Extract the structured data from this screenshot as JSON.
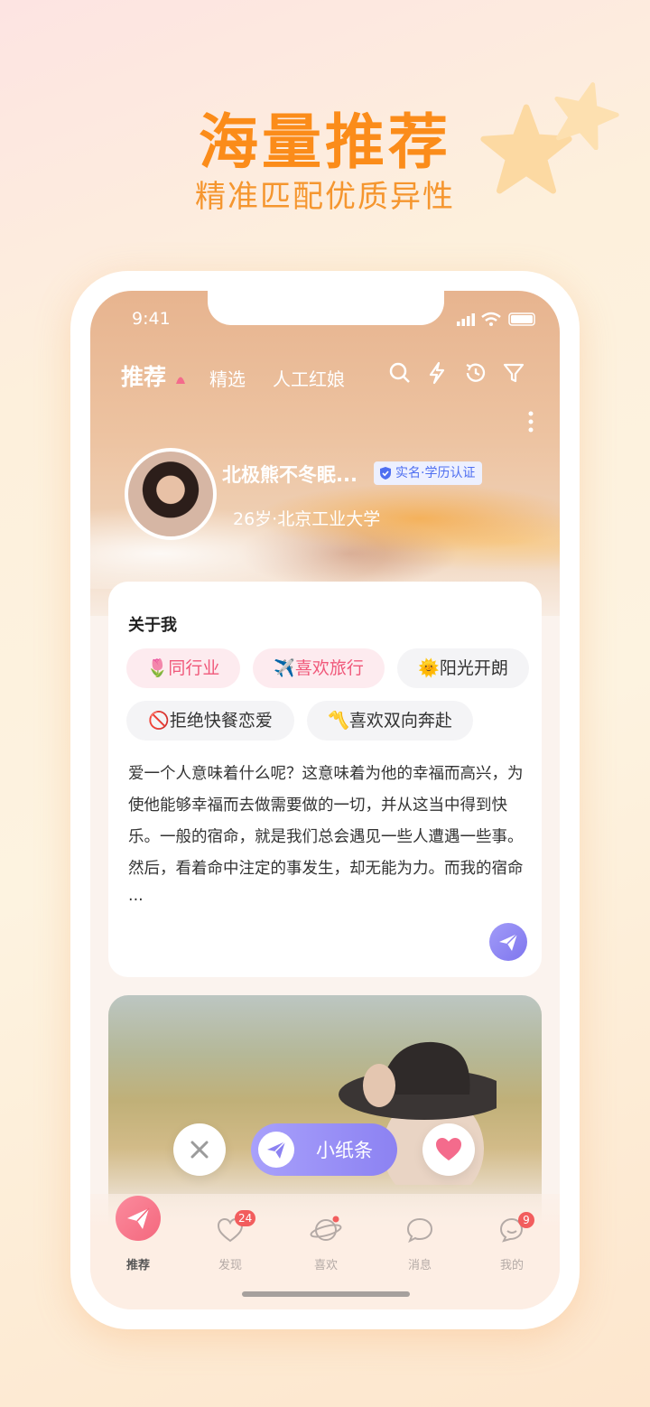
{
  "hero": {
    "title": "海量推荐",
    "subtitle": "精准匹配优质异性"
  },
  "status_bar": {
    "time": "9:41"
  },
  "nav": {
    "tabs": [
      {
        "label": "推荐",
        "active": true
      },
      {
        "label": "精选",
        "active": false
      },
      {
        "label": "人工红娘",
        "active": false
      }
    ],
    "icons": [
      "search-icon",
      "lightning-icon",
      "history-icon",
      "filter-icon"
    ]
  },
  "profile": {
    "name": "北极熊不冬眠...",
    "badge": "实名·学历认证",
    "info": "26岁·北京工业大学"
  },
  "about": {
    "title": "关于我",
    "tags": [
      {
        "emoji": "🌷",
        "label": "同行业",
        "bg": "#fdebef",
        "color": "#f0587a"
      },
      {
        "emoji": "✈️",
        "label": "喜欢旅行",
        "bg": "#fdebef",
        "color": "#f0587a"
      },
      {
        "emoji": "🌞",
        "label": "阳光开朗",
        "bg": "#f4f4f6",
        "color": "#333333"
      },
      {
        "emoji": "🚫",
        "label": "拒绝快餐恋爱",
        "bg": "#f4f4f6",
        "color": "#333333"
      },
      {
        "emoji": "〽️",
        "label": "喜欢双向奔赴",
        "bg": "#f4f4f6",
        "color": "#333333"
      }
    ],
    "bio": "爱一个人意味着什么呢？这意味着为他的幸福而高兴，为使他能够幸福而去做需要做的一切，并从这当中得到快乐。一般的宿命，就是我们总会遇见一些人遭遇一些事。然后，看着命中注定的事发生，却无能为力。而我的宿命···"
  },
  "actions": {
    "note_label": "小纸条"
  },
  "tabbar": [
    {
      "label": "推荐",
      "icon": "paper-plane-icon",
      "active": true,
      "count": ""
    },
    {
      "label": "发现",
      "icon": "heart-outline-icon",
      "active": false,
      "count": "24"
    },
    {
      "label": "喜欢",
      "icon": "planet-icon",
      "active": false,
      "count": ""
    },
    {
      "label": "消息",
      "icon": "chat-bubble-icon",
      "active": false,
      "count": ""
    },
    {
      "label": "我的",
      "icon": "profile-icon",
      "active": false,
      "count": "9"
    }
  ],
  "colors": {
    "accent": "#fb8c1a",
    "pink": "#f0587a",
    "purple": "#8c82f2",
    "badge_blue": "#4f6ff1"
  }
}
